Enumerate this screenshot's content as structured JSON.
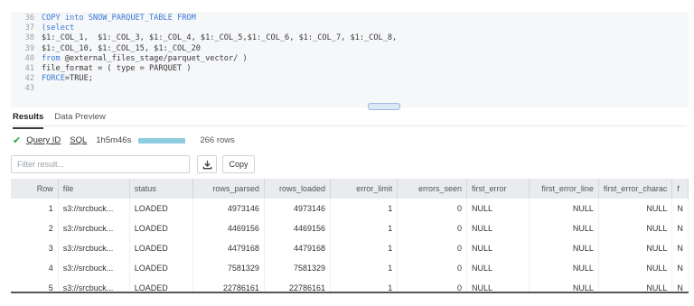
{
  "editor": {
    "lines": [
      {
        "num": "36",
        "parts": [
          {
            "t": "COPY ",
            "k": "kw"
          },
          {
            "t": "into ",
            "k": "kw"
          },
          {
            "t": "SNOW_PARQUET_TABLE ",
            "k": "kw"
          },
          {
            "t": "FROM",
            "k": "kw"
          }
        ]
      },
      {
        "num": "37",
        "parts": [
          {
            "t": "(select",
            "k": "kw"
          }
        ]
      },
      {
        "num": "38",
        "parts": [
          {
            "t": "$1:_COL_1,  $1:_COL_3, $1:_COL_4, $1:_COL_5,$1:_COL_6, $1:_COL_7, $1:_COL_8,",
            "k": "str"
          }
        ]
      },
      {
        "num": "39",
        "parts": [
          {
            "t": "$1:_COL_10, $1:_COL_15, $1:_COL_20",
            "k": "str"
          }
        ]
      },
      {
        "num": "40",
        "parts": [
          {
            "t": "from ",
            "k": "kw"
          },
          {
            "t": "@external_files_stage/parquet_vector/ )",
            "k": "str"
          }
        ]
      },
      {
        "num": "41",
        "parts": [
          {
            "t": "file_format = ( type = PARQUET )",
            "k": "str"
          }
        ]
      },
      {
        "num": "42",
        "parts": [
          {
            "t": "FORCE",
            "k": "kw"
          },
          {
            "t": "=TRUE;",
            "k": "str"
          }
        ]
      },
      {
        "num": "43",
        "parts": []
      }
    ]
  },
  "tabs": [
    {
      "label": "Results",
      "active": true
    },
    {
      "label": "Data Preview",
      "active": false
    }
  ],
  "status": {
    "query_id_label": "Query ID",
    "sql_label": "SQL",
    "duration": "1h5m46s",
    "progress": 1.0,
    "rows": "266 rows"
  },
  "toolbar": {
    "filter_placeholder": "Filter result...",
    "copy_label": "Copy"
  },
  "table": {
    "columns": [
      "Row",
      "file",
      "status",
      "rows_parsed",
      "rows_loaded",
      "error_limit",
      "errors_seen",
      "first_error",
      "first_error_line",
      "first_error_charac",
      "f"
    ],
    "rows": [
      [
        "1",
        "s3://srcbuck...",
        "LOADED",
        "4973146",
        "4973146",
        "1",
        "0",
        "NULL",
        "NULL",
        "NULL",
        "N"
      ],
      [
        "2",
        "s3://srcbuck...",
        "LOADED",
        "4469156",
        "4469156",
        "1",
        "0",
        "NULL",
        "NULL",
        "NULL",
        "N"
      ],
      [
        "3",
        "s3://srcbuck...",
        "LOADED",
        "4479168",
        "4479168",
        "1",
        "0",
        "NULL",
        "NULL",
        "NULL",
        "N"
      ],
      [
        "4",
        "s3://srcbuck...",
        "LOADED",
        "7581329",
        "7581329",
        "1",
        "0",
        "NULL",
        "NULL",
        "NULL",
        "N"
      ],
      [
        "5",
        "s3://srcbuck...",
        "LOADED",
        "22786161",
        "22786161",
        "1",
        "0",
        "NULL",
        "NULL",
        "NULL",
        "N"
      ]
    ]
  },
  "colors": {
    "keyword": "#3b78d8",
    "success": "#27a645",
    "progress_fill": "#8ecce0"
  },
  "icons": {
    "status": "check-icon",
    "download": "download-icon"
  }
}
